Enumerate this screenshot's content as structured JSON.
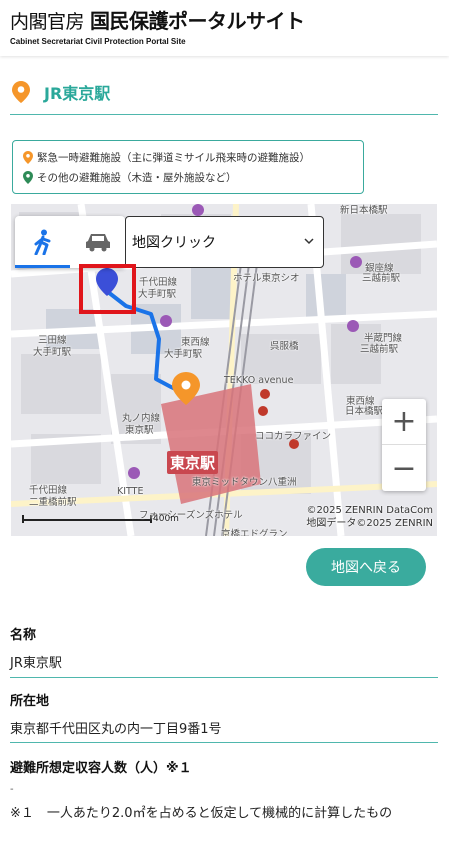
{
  "header": {
    "org": "内閣官房",
    "site_name": "国民保護ポータルサイト",
    "subtitle": "Cabinet Secretariat Civil Protection Portal Site"
  },
  "page": {
    "title": "JR東京駅",
    "pin_color": "#f5962a",
    "accent_color": "#2aa89a"
  },
  "legend": {
    "items": [
      {
        "label": "緊急一時避難施設（主に弾道ミサイル飛来時の避難施設）",
        "color": "#f5962a"
      },
      {
        "label": "その他の避難施設（木造・屋外施設など）",
        "color": "#2e8b57"
      }
    ]
  },
  "map": {
    "mode_select": "地図クリック",
    "labels": {
      "shin_nihombashi": "新日本橋駅",
      "ginza_line": "銀座線",
      "mitsukoshimae": "三越前駅",
      "hotel": "ホテル東京シオ",
      "hanzomon": "半蔵門線",
      "mitsukoshimae2": "三越前駅",
      "chiyoda": "千代田線",
      "otemachi": "大手町駅",
      "mita": "三田線",
      "otemachi2": "大手町駅",
      "tozai": "東西線",
      "otemachi3": "大手町駅",
      "gofukubashi": "呉服橋",
      "tekko": "TEKKO avenue",
      "tozai2": "東西線",
      "nihombashi": "日本橋駅",
      "marunouchi": "丸ノ内線",
      "tokyo_st_small": "東京駅",
      "cocoka": "ココカラファイン",
      "tokyo_station": "東京駅",
      "midtown": "東京ミッドタウン八重洲",
      "chiyoda2": "千代田線",
      "nijubashi": "二重橋前駅",
      "kitte": "KITTE",
      "four_seasons": "フォーシーズンズホテル",
      "edo_grand": "京橋エドグラン"
    },
    "copyright_1": "©2025 ZENRIN DataCom",
    "copyright_2": "地図データ©2025 ZENRIN",
    "scale": "400m",
    "zoom_in": "+",
    "zoom_out": "−"
  },
  "back_button": "地図へ戻る",
  "details": {
    "name_label": "名称",
    "name_value": "JR東京駅",
    "address_label": "所在地",
    "address_value": "東京都千代田区丸の内一丁目9番1号",
    "capacity_label": "避難所想定収容人数（人）※１",
    "capacity_value": "-",
    "note": "※１　一人あたり2.0㎡を占めると仮定して機械的に計算したもの"
  }
}
